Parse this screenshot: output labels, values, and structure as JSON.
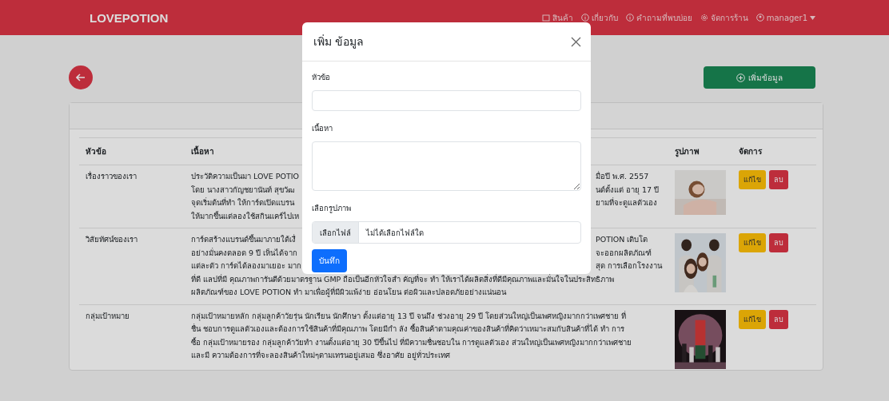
{
  "navbar": {
    "brand": "LOVEPOTION",
    "items": [
      {
        "kind": "box",
        "label": "สินค้า"
      },
      {
        "kind": "info",
        "label": "เกี่ยวกับ"
      },
      {
        "kind": "info",
        "label": "คำถามที่พบบ่อย"
      },
      {
        "kind": "gear",
        "label": "จัดการร้าน"
      }
    ],
    "user": "manager1"
  },
  "add_button": "เพิ่มข้อมูล",
  "table": {
    "columns": [
      "หัวข้อ",
      "เนื้อหา",
      "รูปภาพ",
      "จัดการ"
    ],
    "rows": [
      {
        "title": "เรื่องราวของเรา",
        "lines": [
          {
            "left": "ประวัติความเป็นมา LOVE POTIO",
            "right": "มื่อปี พ.ศ. 2557"
          },
          {
            "left": "โดย นางสาวกัญชยานันท์ สุขวัฒ",
            "right": "นด์ตั้งแต่ อายุ 17 ปี"
          },
          {
            "left": "จุดเริ่มต้นที่ทำ ให้การ์ดเปิดแบรน",
            "right": "ยามที่จะดูแลตัวเอง"
          },
          {
            "left": "ให้มากขึ้นแต่ลองใช้สกินแคร์ไปเห"
          }
        ],
        "actions": [
          "แก้ไข",
          "ลบ"
        ]
      },
      {
        "title": "วิสัยทัศน์ของเรา",
        "lines": [
          {
            "left": "การ์ดสร้างแบรนด์ขึ้นมาภายใต้เงื่",
            "right": "POTION เติบโต"
          },
          {
            "left": "อย่างมั่นคงตลอด 9 ปี เห็นได้จาก",
            "right": "จะออกผลิตภัณฑ์"
          },
          {
            "left": "แต่ละตัว การ์ดได้ลองมาเยอะ มาก",
            "right": "สุด การเลือกโรงงาน"
          },
          {
            "text": "ที่ดี แลปที่มี คุณภาพการันตีด้วยมาตรฐาน GMP ถือเป็นอีกหัวใจสำ คัญที่จะ ทำ ให้เราได้ผลิตสิ่งที่ดีมีคุณภาพและมั่นใจในประสิทธิภาพ"
          },
          {
            "text": "ผลิตภัณฑ์ของ LOVE POTION ทำ มาเพื่อผู้ที่มีผิวแพ้ง่าย อ่อนโยน ต่อผิวและปลอดภัยอย่างแน่นอน"
          }
        ],
        "actions": [
          "แก้ไข",
          "ลบ"
        ]
      },
      {
        "title": "กลุ่มเป้าหมาย",
        "lines": [
          {
            "text": "กลุ่มเป้าหมายหลัก กลุ่มลูกค้าวัยรุ่น นักเรียน นักศึกษา ตั้งแต่อายุ 13 ปี จนถึง ช่วงอายุ 29 ปี โดยส่วนใหญ่เป็นเพศหญิงมากกว่าเพศชาย ที่"
          },
          {
            "text": "ชื่น ชอบการดูแลตัวเองและต้องการใช้สินค้าที่มีคุณภาพ โดยมีกำ ลัง ซื้อสินค้าตามคุณค่าของสินค้าที่คิดว่าเหมาะสมกับสินค้าที่ได้ ทำ การ"
          },
          {
            "text": "ซื้อ กลุ่มเป้าหมายรอง กลุ่มลูกค้าวัยทำ งานตั้งแต่อายุ 30 ปีขึ้นไป ที่มีความชื่นชอบใน การดูแลตัวเอง ส่วนใหญ่เป็นเพศหญิงมากกว่าเพศชาย"
          },
          {
            "text": "และมี ความต้องการที่จะลองสินค้าใหม่ๆตามเทรนอยู่เสมอ ซึ่งอาศัย อยู่ทั่วประเทศ"
          }
        ],
        "actions": [
          "แก้ไข",
          "ลบ"
        ]
      }
    ]
  },
  "modal": {
    "title": "เพิ่ม ข้อมูล",
    "fields": [
      {
        "kind": "text",
        "label": "หัวข้อ"
      },
      {
        "kind": "textarea",
        "label": "เนื้อหา"
      },
      {
        "kind": "file",
        "label": "เลือกรูปภาพ",
        "button": "เลือกไฟล์",
        "value": "ไม่ได้เลือกไฟล์ใด"
      }
    ],
    "submit": "บันทึก"
  }
}
